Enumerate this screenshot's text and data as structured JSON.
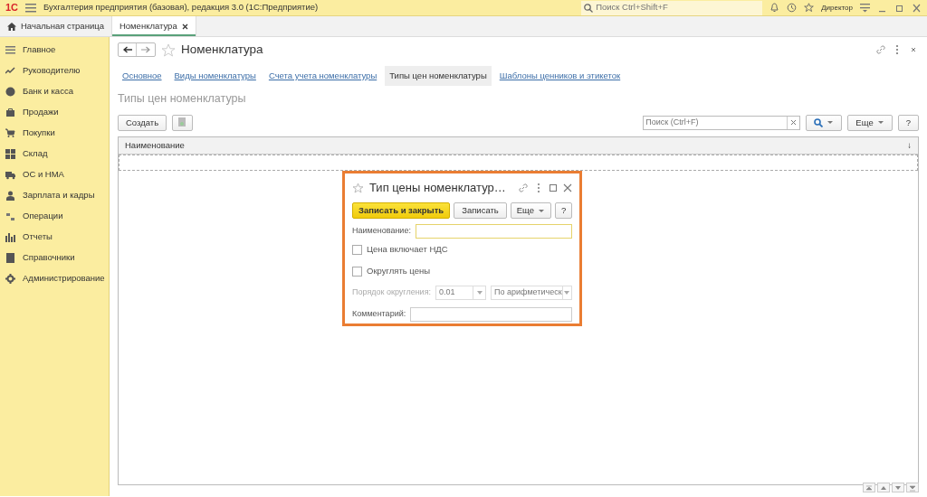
{
  "app": {
    "logo": "1С",
    "title": "Бухгалтерия предприятия (базовая), редакция 3.0  (1С:Предприятие)",
    "search": {
      "placeholder": "Поиск Ctrl+Shift+F"
    },
    "user": "Директор"
  },
  "tabs": [
    {
      "label": "Начальная страница",
      "kind": "home",
      "selected": false
    },
    {
      "label": "Номенклатура",
      "kind": "closable",
      "selected": true
    }
  ],
  "sidebar": {
    "items": [
      {
        "label": "Главное"
      },
      {
        "label": "Руководителю"
      },
      {
        "label": "Банк и касса"
      },
      {
        "label": "Продажи"
      },
      {
        "label": "Покупки"
      },
      {
        "label": "Склад"
      },
      {
        "label": "ОС и НМА"
      },
      {
        "label": "Зарплата и кадры"
      },
      {
        "label": "Операции"
      },
      {
        "label": "Отчеты"
      },
      {
        "label": "Справочники"
      },
      {
        "label": "Администрирование"
      }
    ]
  },
  "form": {
    "title": "Номенклатура",
    "links": [
      {
        "label": "Основное",
        "selected": false
      },
      {
        "label": "Виды номенклатуры",
        "selected": false
      },
      {
        "label": "Счета учета номенклатуры",
        "selected": false
      },
      {
        "label": "Типы цен номенклатуры",
        "selected": true
      },
      {
        "label": "Шаблоны ценников и этикеток",
        "selected": false
      }
    ],
    "section_title": "Типы цен номенклатуры",
    "create_button": "Создать",
    "search": {
      "placeholder": "Поиск (Ctrl+F)"
    },
    "more_button": "Еще",
    "help_button": "?",
    "table": {
      "columns": [
        {
          "label": "Наименование",
          "sort": "↓"
        }
      ]
    }
  },
  "dialog": {
    "title": "Тип цены номенклатур…",
    "buttons": [
      {
        "label": "Записать и закрыть",
        "kind": "primary"
      },
      {
        "label": "Записать",
        "kind": "default"
      },
      {
        "label": "Еще",
        "kind": "dropdown"
      },
      {
        "label": "?",
        "kind": "default"
      }
    ],
    "name_field": {
      "label": "Наименование:",
      "focused": true
    },
    "checkboxes": [
      {
        "label": "Цена включает НДС",
        "checked": false
      },
      {
        "label": "Округлять цены",
        "checked": false
      }
    ],
    "rounding": {
      "label": "Порядок округления:",
      "value": "0.01",
      "method": "По арифметическ",
      "disabled": true
    },
    "comment_field": {
      "label": "Комментарий:"
    }
  }
}
